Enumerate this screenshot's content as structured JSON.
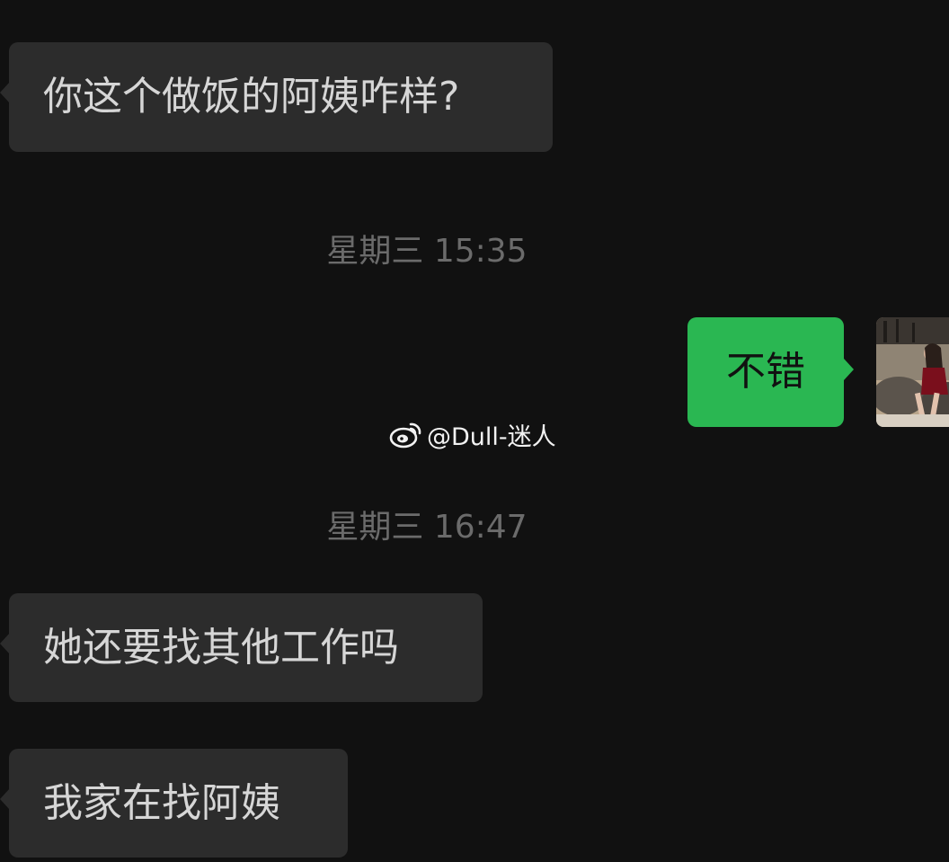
{
  "messages": [
    {
      "direction": "in",
      "text": "你这个做饭的阿姨咋样?"
    },
    {
      "direction": "out",
      "text": "不错"
    },
    {
      "direction": "in",
      "text": "她还要找其他工作吗"
    },
    {
      "direction": "in",
      "text": "我家在找阿姨"
    }
  ],
  "timestamps": [
    "星期三 15:35",
    "星期三 16:47"
  ],
  "watermark": {
    "text": "@Dull-迷人",
    "icon": "weibo-icon"
  },
  "avatar": {
    "icon": "user-avatar-photo"
  },
  "colors": {
    "background": "#111111",
    "incoming_bubble": "#2c2c2c",
    "outgoing_bubble": "#2ab752",
    "incoming_text": "#d6d6d6",
    "timestamp_text": "#6b6b6b"
  }
}
